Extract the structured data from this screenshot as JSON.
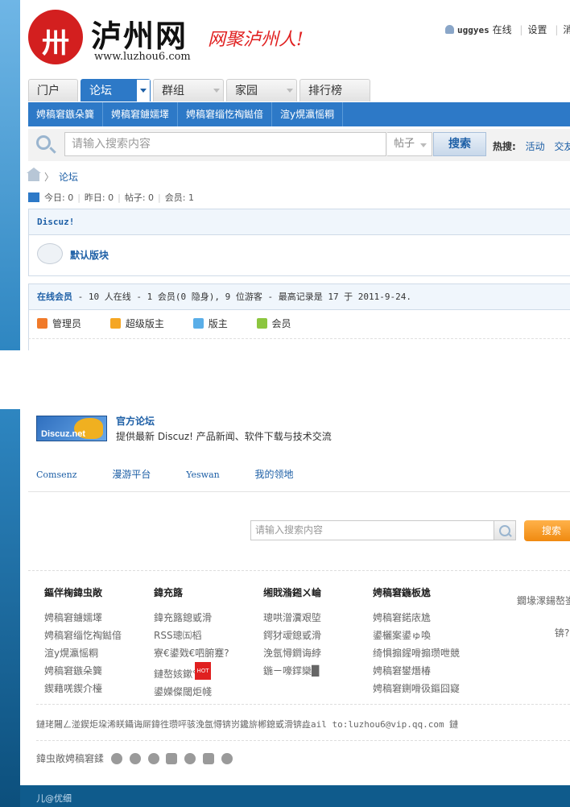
{
  "header": {
    "logo_mark": "卅",
    "logo_text": "泸州网",
    "logo_url": "www.luzhou6.com",
    "slogan": "网聚泸州人!",
    "username": "uggyes",
    "status": "在线",
    "settings": "设置",
    "messages": "消"
  },
  "nav": {
    "tabs": [
      "门户",
      "论坛",
      "群组",
      "家园",
      "排行榜"
    ],
    "active_tab": "论坛",
    "subnav": [
      "娉稿窘鏃朵簨",
      "娉稿窘鐪嬬墿",
      "娉稿窘缁忔祹鐑偣",
      "渲у熀瀛愮粡"
    ]
  },
  "search": {
    "placeholder": "请输入搜索内容",
    "type": "帖子",
    "button": "搜索",
    "hot_label": "热搜:",
    "hot_items": [
      "活动",
      "交友"
    ]
  },
  "breadcrumb": {
    "current": "论坛"
  },
  "stats": {
    "today": "今日: 0",
    "yesterday": "昨日: 0",
    "posts": "帖子: 0",
    "members": "会员: 1"
  },
  "forum": {
    "category": "Discuz!",
    "board": "默认版块"
  },
  "online": {
    "title": "在线会员",
    "summary": " - 10 人在线 - 1 会员(0 隐身), 9 位游客 - 最高记录是 17 于 2011-9-24.",
    "legend": [
      {
        "label": "管理员",
        "color": "#f07a2a"
      },
      {
        "label": "超级版主",
        "color": "#f5a623"
      },
      {
        "label": "版主",
        "color": "#5aaee8"
      },
      {
        "label": "会员",
        "color": "#8cc63f"
      }
    ]
  },
  "links": {
    "logo_text": "Discuz.net",
    "title": "官方论坛",
    "description": "提供最新 Discuz! 产品新闻、软件下载与技术交流",
    "partners": [
      "Comsenz",
      "漫游平台",
      "Yeswan",
      "我的领地"
    ]
  },
  "search2": {
    "placeholder": "请输入搜索内容",
    "button": "搜索"
  },
  "footer": {
    "columns": [
      {
        "title": "鏂伴椈鍏虫敞",
        "items": [
          "娉稿窘鐪嬬墿",
          "娉稿窘缁忔祹鐑偣",
          "渲у熀瀛愮粡",
          "娉稿窘鏃朵簨",
          "鍥藉唴鍥介檯"
        ]
      },
      {
        "title": "鍏充簬",
        "items": [
          "鍏充簬鎴戜滑",
          "RSS璁㈤槄",
          "寮€鍙戣€呬腑蹇?",
          "鏈嶅姟鏉℃",
          "鍙嬫儏閾炬帴"
        ]
      },
      {
        "title": "缃戝潃鎺ㄨ崘",
        "items": [
          "璁哄潧瀵艰埅",
          "鍔犲叆鎴戜滑",
          "浼氬憳鐧诲綍",
          "鍦ㄧ嚎鐣欒█"
        ]
      },
      {
        "title": "娉稿窘鍦板尯",
        "items": [
          "娉稿窘鍩庡尯",
          "鍙欐案鍙ゅ喚",
          "绮惧搧鍟嗗搧瓒呭競",
          "娉稿窘鐢熸椿",
          "娉稿窘鍘嗗彶鏂囧寲"
        ]
      }
    ],
    "side_title": "鐗堟潈鍚嶅崟 h 闀",
    "side_note": "锛?",
    "hot_badge": "HOT",
    "info_line": "鏈珯闀ㄥ湴鍥炬垜浠眹鑷诲厛鍏徃瓒呯骇浼氬憳锛岃鑱旂郴鎴戜滑锛歮ail to:luzhou6@vip.qq.com 鏈",
    "share_label": "鍏虫敞娉稿窘鍒",
    "share_icons": [
      "weibo-icon",
      "qq-icon",
      "renren-icon",
      "douban-icon",
      "kaixin-icon",
      "tencent-icon",
      "open-icon"
    ],
    "bottom": "儿@优细"
  },
  "colors": {
    "primary": "#2d79c7",
    "accent_red": "#d31f1f",
    "orange": "#f08a10",
    "link": "#1d5fa6"
  }
}
